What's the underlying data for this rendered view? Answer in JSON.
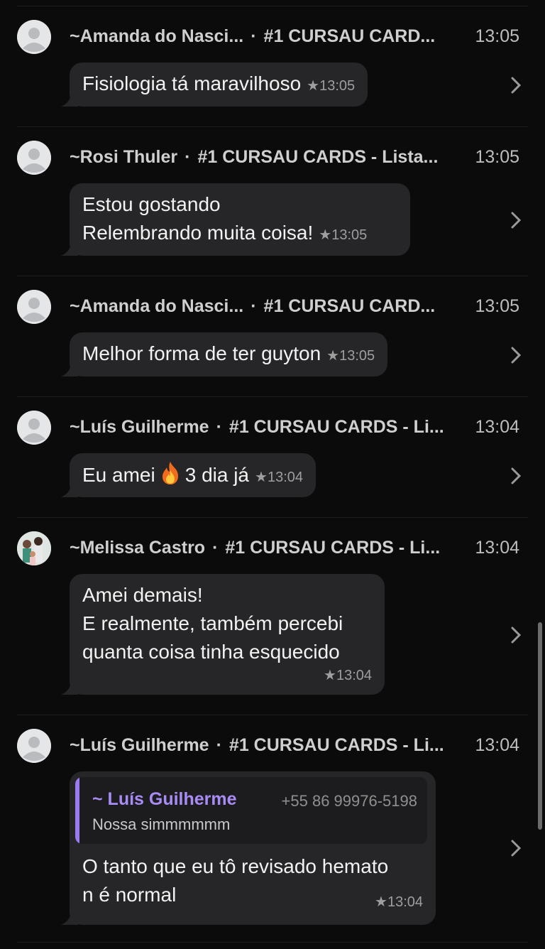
{
  "entries": [
    {
      "sender": "~Amanda do Nasci...",
      "group": "#1 CURSAU CARD...",
      "time": "13:05",
      "message": "Fisiologia tá maravilhoso",
      "msg_time": "★13:05"
    },
    {
      "sender": "~Rosi Thuler",
      "group": "#1 CURSAU CARDS - Lista...",
      "time": "13:05",
      "message_lines": [
        "Estou gostando",
        "Relembrando muita coisa!"
      ],
      "msg_time": "★13:05"
    },
    {
      "sender": "~Amanda do Nasci...",
      "group": "#1 CURSAU CARD...",
      "time": "13:05",
      "message": "Melhor forma de ter guyton",
      "msg_time": "★13:05"
    },
    {
      "sender": "~Luís Guilherme",
      "group": "#1 CURSAU CARDS - Li...",
      "time": "13:04",
      "message_before": "Eu amei",
      "emoji": "fire-emoji",
      "message_after": "3 dia já",
      "msg_time": "★13:04"
    },
    {
      "sender": "~Melissa Castro",
      "group": "#1 CURSAU CARDS - Li...",
      "time": "13:04",
      "message_lines": [
        "Amei demais!",
        "E realmente, também percebi",
        "quanta coisa tinha esquecido"
      ],
      "msg_time": "★13:04"
    },
    {
      "sender": "~Luís Guilherme",
      "group": "#1 CURSAU CARDS - Li...",
      "time": "13:04",
      "quote": {
        "name": "~ Luís Guilherme",
        "phone": "+55 86 99976-5198",
        "text": "Nossa simmmmmm"
      },
      "message_lines": [
        "O tanto que eu tô revisado hemato",
        "n é normal"
      ],
      "msg_time": "★13:04"
    }
  ],
  "separator": "·",
  "colors": {
    "background": "#0b0b0b",
    "bubble": "#262628",
    "quote_accent": "#9b7cf0",
    "meta": "#9e9e9e"
  }
}
